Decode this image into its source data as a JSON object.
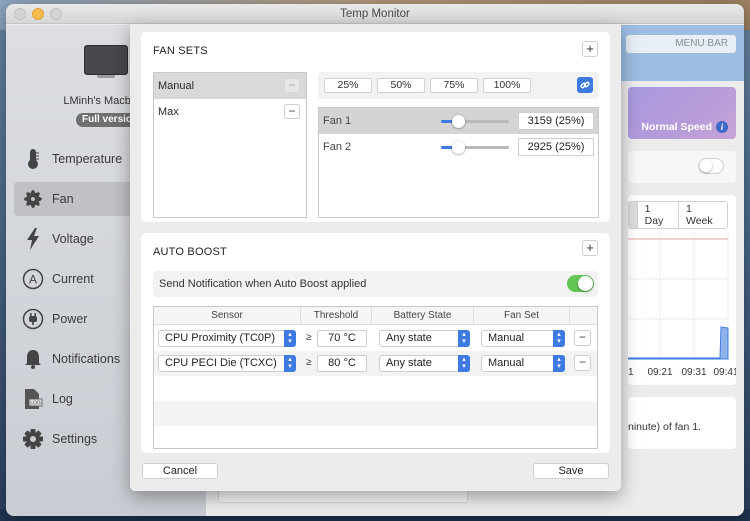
{
  "window": {
    "title": "Temp Monitor"
  },
  "sidebar": {
    "device_name": "LMinh's Macbook",
    "version_badge": "Full version",
    "items": [
      {
        "label": "Temperature",
        "icon": "thermometer-icon",
        "active": false
      },
      {
        "label": "Fan",
        "icon": "fan-icon",
        "active": true
      },
      {
        "label": "Voltage",
        "icon": "lightning-bolt-icon",
        "active": false
      },
      {
        "label": "Current",
        "icon": "ampere-icon",
        "active": false
      },
      {
        "label": "Power",
        "icon": "power-plug-icon",
        "active": false
      },
      {
        "label": "Notifications",
        "icon": "bell-icon",
        "active": false
      },
      {
        "label": "Log",
        "icon": "log-file-icon",
        "active": false
      },
      {
        "label": "Settings",
        "icon": "gear-icon",
        "active": false
      }
    ]
  },
  "background_main": {
    "menu_bar_label": "MENU BAR",
    "speed_label": "Normal Speed",
    "range_tabs": [
      "1 Day",
      "1 Week"
    ],
    "chart_x_labels": [
      "1",
      "09:21",
      "09:31",
      "09:41"
    ],
    "description_fragment": "ninute) of fan 1."
  },
  "fan_sets": {
    "title": "FAN SETS",
    "add_label": "+",
    "sets": [
      {
        "name": "Manual",
        "selected": true
      },
      {
        "name": "Max",
        "selected": false
      }
    ],
    "presets": [
      "25%",
      "50%",
      "75%",
      "100%"
    ],
    "link_icon": "link-icon",
    "fans": [
      {
        "name": "Fan 1",
        "value": "3159 (25%)",
        "percent": 25,
        "selected": true
      },
      {
        "name": "Fan 2",
        "value": "2925 (25%)",
        "percent": 25,
        "selected": false
      }
    ]
  },
  "auto_boost": {
    "title": "AUTO BOOST",
    "add_label": "+",
    "notify_label": "Send Notification when Auto Boost applied",
    "notify_enabled": true,
    "columns": [
      "Sensor",
      "Threshold",
      "Battery State",
      "Fan Set"
    ],
    "rules": [
      {
        "sensor": "CPU Proximity (TC0P)",
        "operator": "≥",
        "threshold": "70 °C",
        "battery_state": "Any state",
        "fan_set": "Manual"
      },
      {
        "sensor": "CPU PECI Die (TCXC)",
        "operator": "≥",
        "threshold": "80 °C",
        "battery_state": "Any state",
        "fan_set": "Manual"
      }
    ]
  },
  "footer": {
    "cancel_label": "Cancel",
    "save_label": "Save"
  },
  "colors": {
    "accent": "#3d7be3",
    "toggle_on": "#62c554",
    "selected_row": "#d9d9d9"
  }
}
